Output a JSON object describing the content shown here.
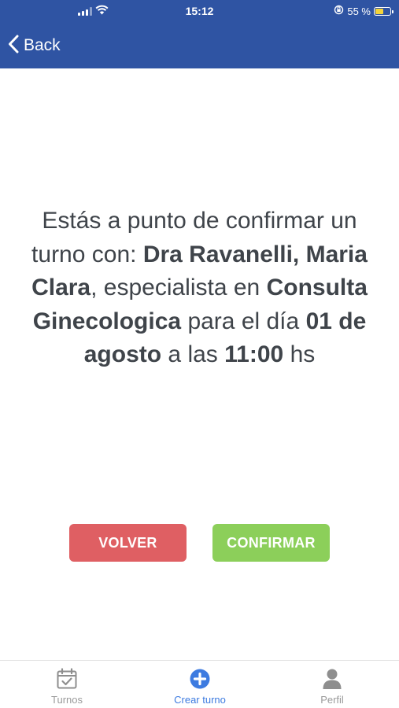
{
  "status_bar": {
    "time": "15:12",
    "battery_text": "55 %",
    "battery_level": 0.55,
    "battery_color": "#f4d43a"
  },
  "nav": {
    "back_label": "Back",
    "background": "#2f54a3"
  },
  "message": {
    "line_intro": "Estás a punto de confirmar un turno con:",
    "doctor": "Dra Ravanelli, Maria Clara",
    "specialist_text": ", especialista en",
    "specialty": "Consulta Ginecologica",
    "date_prefix": "para el día",
    "date": "01 de agosto",
    "date_suffix": "a las",
    "time": "11:00",
    "time_suffix": "hs"
  },
  "buttons": {
    "volver_label": "VOLVER",
    "confirmar_label": "CONFIRMAR",
    "volver_color": "#df5f63",
    "confirmar_color": "#8ccf5a"
  },
  "tab_bar": {
    "items": [
      {
        "label": "Turnos",
        "icon": "calendar-check-icon",
        "active": false
      },
      {
        "label": "Crear turno",
        "icon": "plus-circle-icon",
        "active": true
      },
      {
        "label": "Perfil",
        "icon": "user-icon",
        "active": false
      }
    ],
    "active_color": "#3d7be0",
    "inactive_color": "#9a9a9a"
  }
}
